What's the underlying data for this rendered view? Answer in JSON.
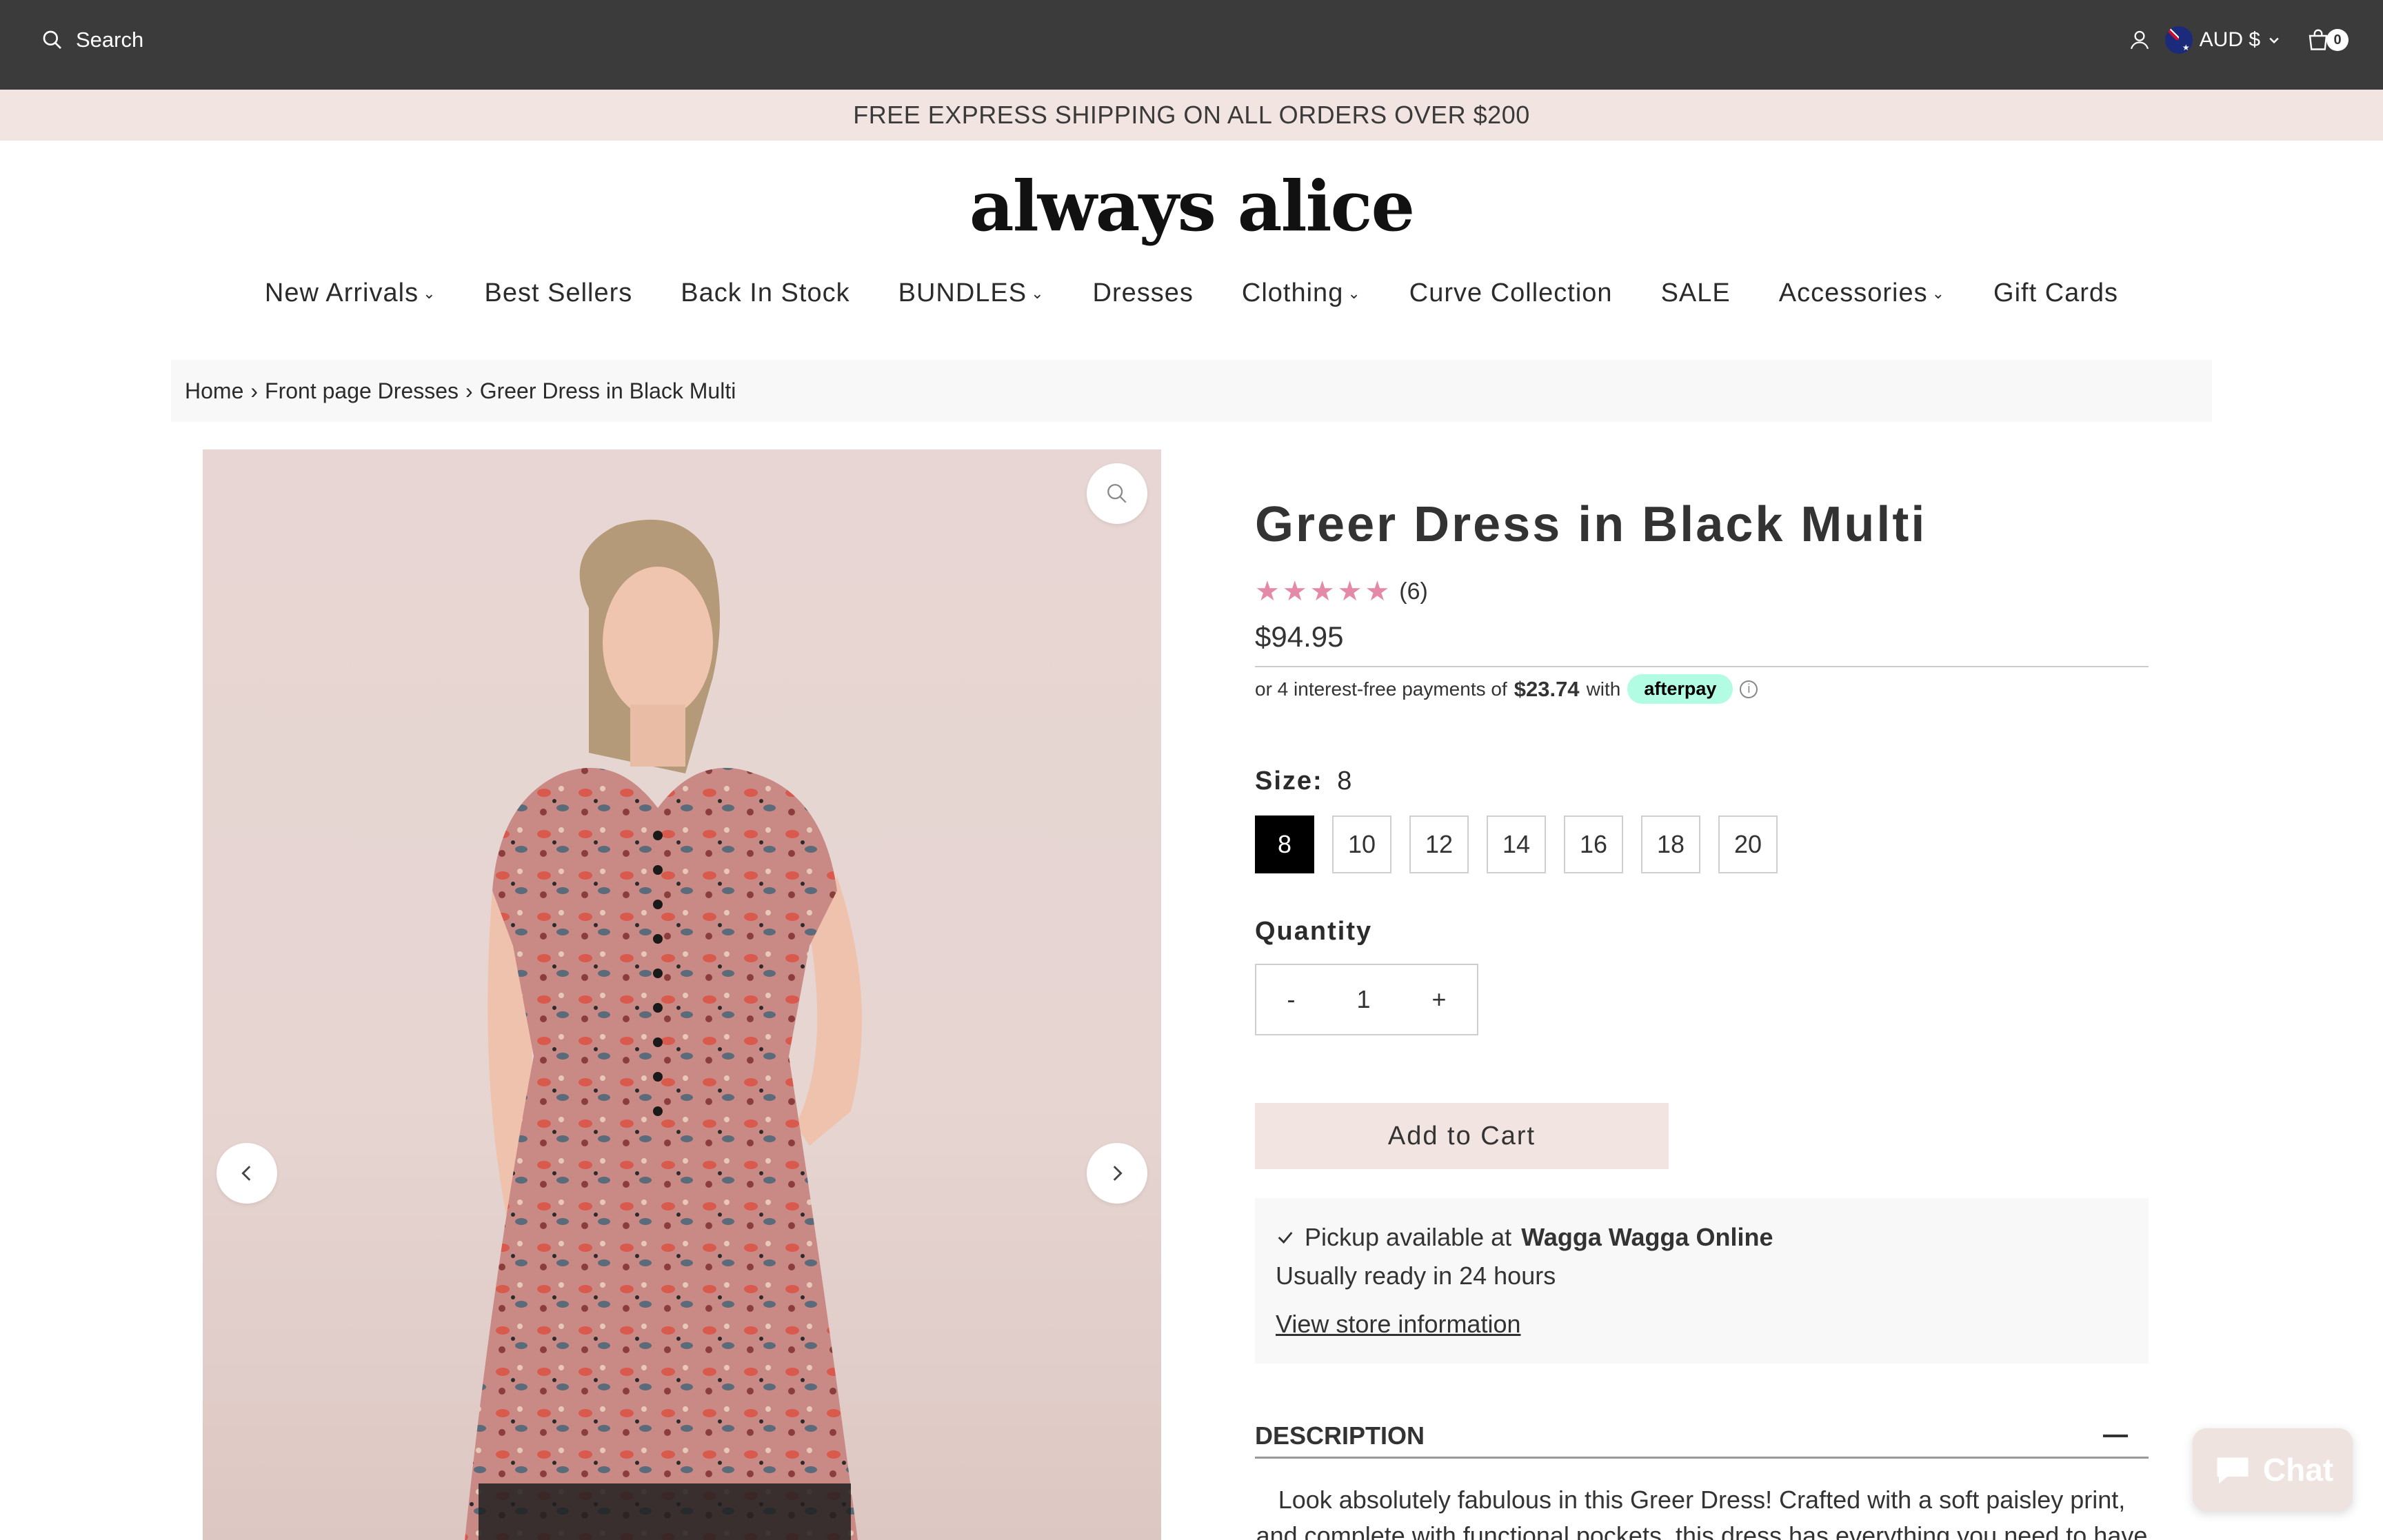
{
  "topbar": {
    "search_label": "Search",
    "currency": "AUD $",
    "cart_count": "0"
  },
  "banner": {
    "text": "FREE EXPRESS SHIPPING ON ALL ORDERS OVER $200"
  },
  "logo": {
    "text": "always alice"
  },
  "nav": {
    "items": [
      {
        "label": "New Arrivals",
        "dropdown": true
      },
      {
        "label": "Best Sellers",
        "dropdown": false
      },
      {
        "label": "Back In Stock",
        "dropdown": false
      },
      {
        "label": "BUNDLES",
        "dropdown": true
      },
      {
        "label": "Dresses",
        "dropdown": false
      },
      {
        "label": "Clothing",
        "dropdown": true
      },
      {
        "label": "Curve Collection",
        "dropdown": false
      },
      {
        "label": "SALE",
        "dropdown": false
      },
      {
        "label": "Accessories",
        "dropdown": true
      },
      {
        "label": "Gift Cards",
        "dropdown": false
      }
    ]
  },
  "breadcrumb": {
    "home": "Home",
    "sep": "›",
    "collection": "Front page Dresses",
    "current": "Greer Dress in Black Multi"
  },
  "product": {
    "title": "Greer Dress in Black Multi",
    "rating_stars": 5,
    "review_count": "(6)",
    "price": "$94.95",
    "afterpay": {
      "prefix": "or 4 interest-free payments of",
      "amount": "$23.74",
      "with": "with",
      "brand": "afterpay",
      "info": "i"
    },
    "size_label": "Size:",
    "selected_size": "8",
    "sizes": [
      "8",
      "10",
      "12",
      "14",
      "16",
      "18",
      "20"
    ],
    "quantity_label": "Quantity",
    "quantity": {
      "minus": "-",
      "value": "1",
      "plus": "+"
    },
    "add_to_cart": "Add to Cart",
    "pickup": {
      "prefix": "Pickup available at",
      "store": "Wagga Wagga Online",
      "ready": "Usually ready in 24 hours",
      "link": "View store information"
    },
    "description": {
      "heading": "DESCRIPTION",
      "text": "Look absolutely fabulous in this Greer Dress! Crafted with a soft paisley print, and complete with functional pockets, this dress has everything you need to have everyone"
    }
  },
  "chat": {
    "label": "Chat"
  },
  "colors": {
    "topbar": "#3b3b3b",
    "banner": "#f1e4e1",
    "star": "#e48aa8",
    "afterpay": "#b2fce4",
    "selected_size": "#000000"
  }
}
